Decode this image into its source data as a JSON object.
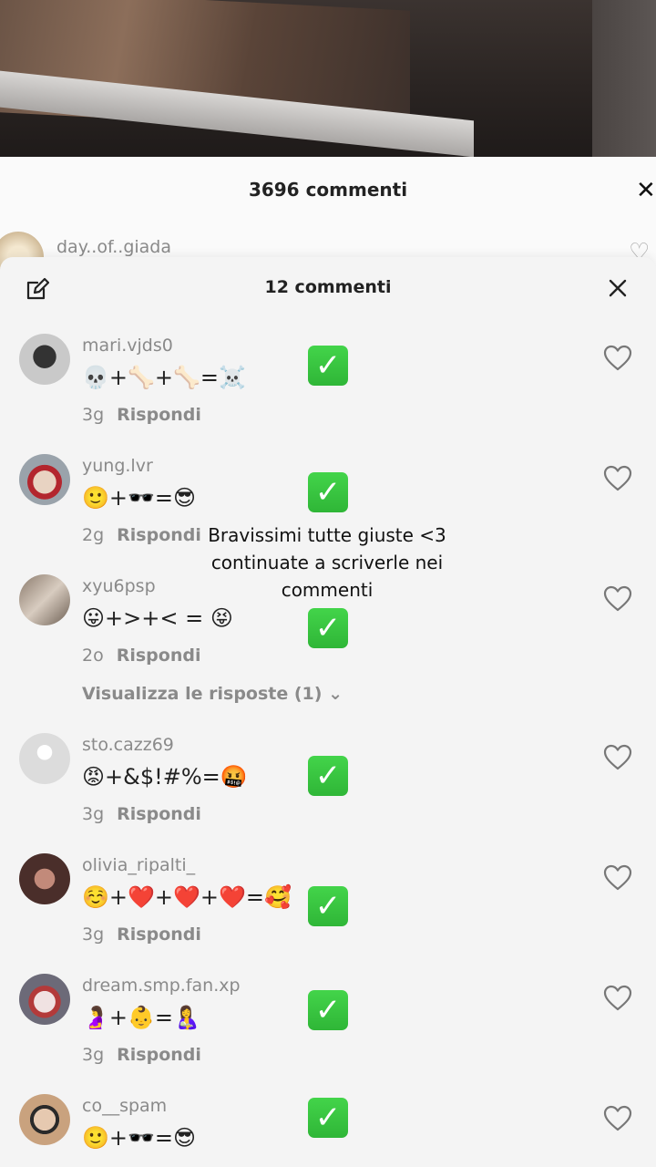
{
  "back_sheet": {
    "title": "3696 commenti",
    "close_glyph": "✕",
    "peek_username": "day..of..giada",
    "peek_heart": "♡"
  },
  "sheet": {
    "title": "12 commenti",
    "view_replies": "Visualizza le risposte (1)",
    "view_replies_chevron": "⌄"
  },
  "overlay_text": "Bravissimi tutte giuste <3 continuate a scriverle nei commenti",
  "reply_label": "Rispondi",
  "check_glyph": "✓",
  "comments": [
    {
      "username": "mari.vjds0",
      "text": "💀+🦴+🦴=☠️",
      "time": "3g"
    },
    {
      "username": "yung.lvr",
      "text": "🙂+🕶️=😎",
      "time": "2g"
    },
    {
      "username": "xyu6psp",
      "text": "😛+>+< = 😝",
      "time": "2o"
    },
    {
      "username": "sto.cazz69",
      "text": "😡+&$!#%=🤬",
      "time": "3g"
    },
    {
      "username": "olivia_ripalti_",
      "text": "☺️+❤️+❤️+❤️=🥰",
      "time": "3g"
    },
    {
      "username": "dream.smp.fan.xp",
      "text": "🤰+👶=🤱",
      "time": "3g"
    },
    {
      "username": "co__spam",
      "text": "🙂+🕶️=😎",
      "time": ""
    }
  ],
  "colors": {
    "check_green": "#2fb637",
    "muted_text": "#8a8a8a"
  }
}
